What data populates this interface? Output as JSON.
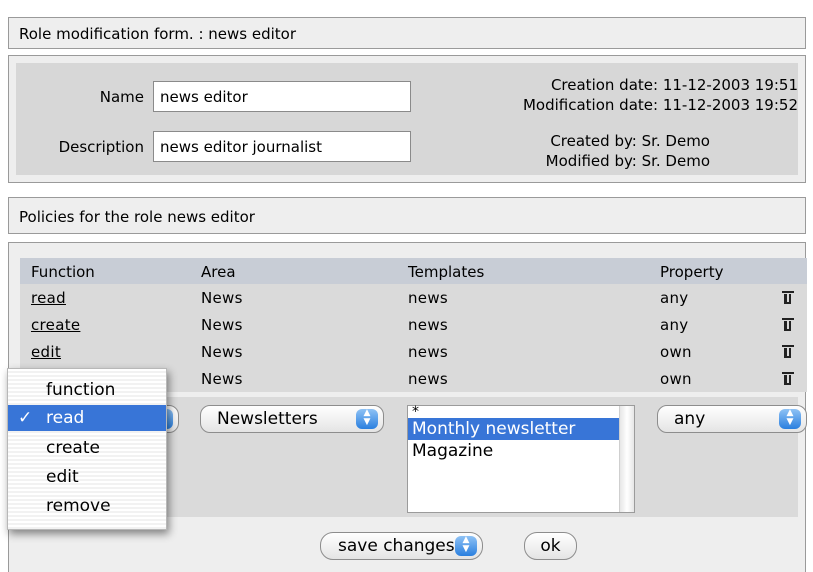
{
  "header": {
    "title": "Role modification form. : news editor"
  },
  "role": {
    "name_label": "Name",
    "name_value": "news editor",
    "description_label": "Description",
    "description_value": "news editor journalist",
    "creation_date": "Creation date: 11-12-2003 19:51",
    "modification_date": "Modification date: 11-12-2003 19:52",
    "created_by": "Created by: Sr. Demo",
    "modified_by": "Modified by: Sr. Demo"
  },
  "policies": {
    "title": "Policies for the role news editor",
    "columns": [
      "Function",
      "Area",
      "Templates",
      "Property"
    ],
    "rows": [
      {
        "function": "read",
        "area": "News",
        "template": "news",
        "property": "any"
      },
      {
        "function": "create",
        "area": "News",
        "template": "news",
        "property": "any"
      },
      {
        "function": "edit",
        "area": "News",
        "template": "news",
        "property": "own"
      },
      {
        "function": "",
        "area": "News",
        "template": "news",
        "property": "own"
      }
    ]
  },
  "new_policy": {
    "area_selected": "Newsletters",
    "templates": [
      "*",
      "Monthly newsletter",
      "Magazine"
    ],
    "templates_selected": "Monthly newsletter",
    "property_selected": "any"
  },
  "function_menu": {
    "items": [
      "function",
      "read",
      "create",
      "edit",
      "remove"
    ],
    "selected": "read",
    "check_glyph": "✓"
  },
  "actions": {
    "action_selected": "save changes",
    "ok_label": "ok"
  },
  "icons": {
    "delete": "trash-icon",
    "popup_arrows": "updown-arrows-icon"
  },
  "colors": {
    "selection": "#3875d7",
    "header_row": "#c8cdd6",
    "panel": "#d7d7d7"
  }
}
